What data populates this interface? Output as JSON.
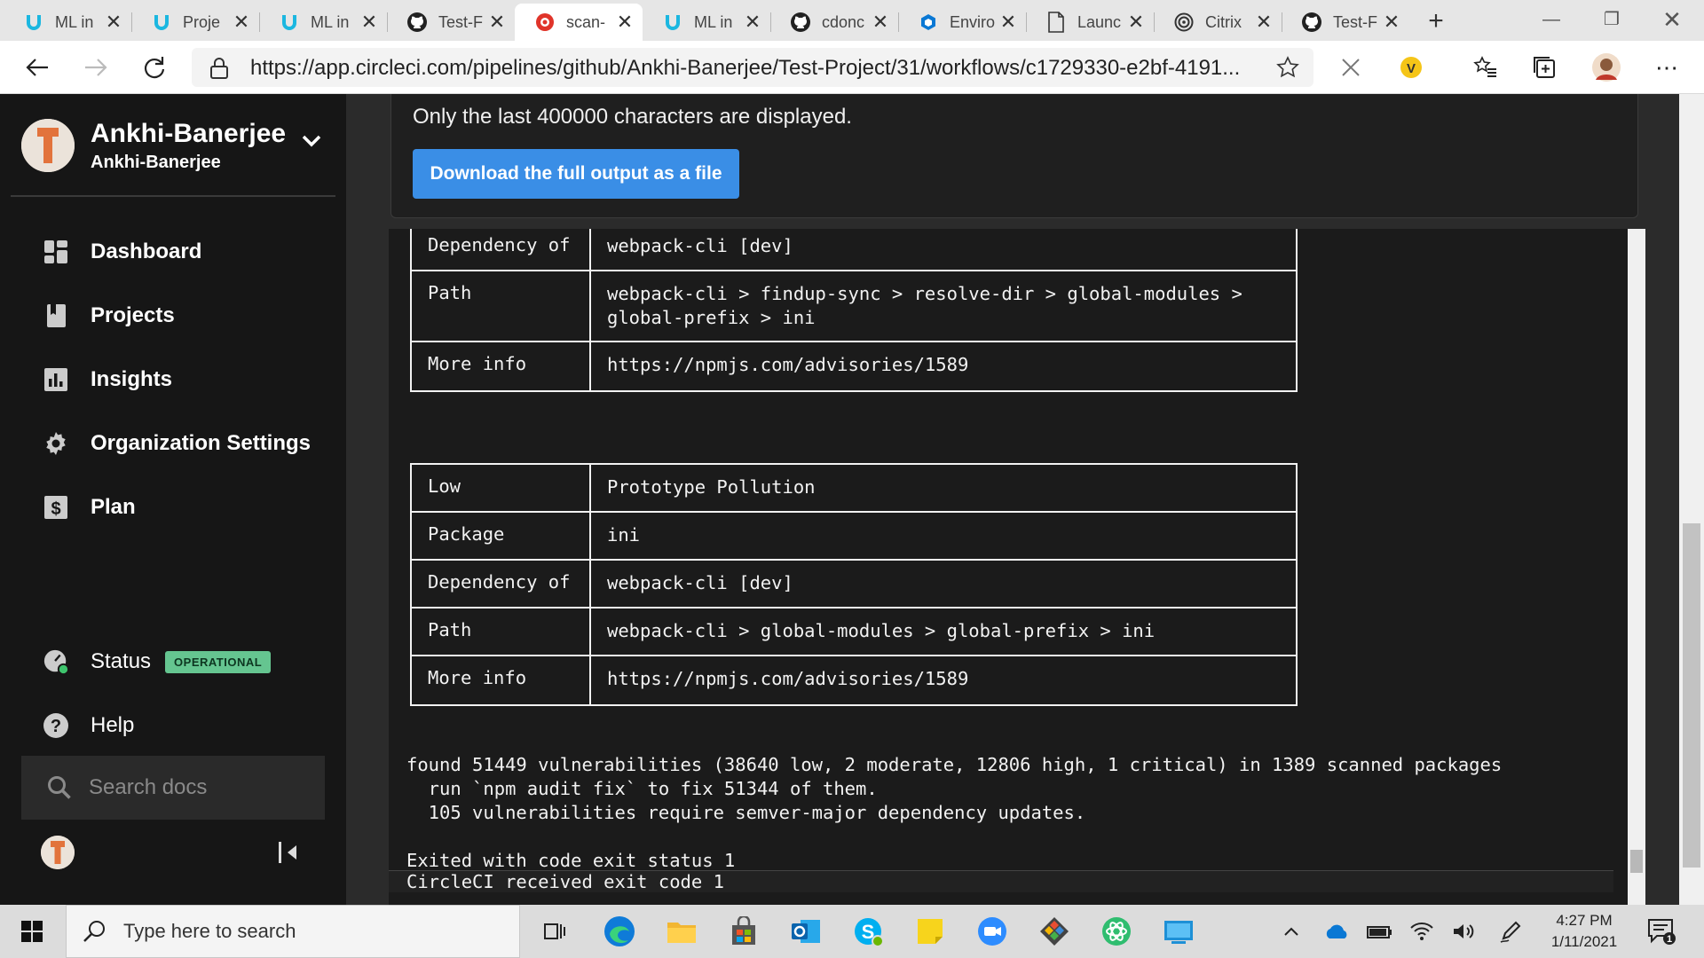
{
  "browser": {
    "tabs": [
      {
        "title": "ML in",
        "icon": "udacity-icon"
      },
      {
        "title": "Proje",
        "icon": "udacity-icon"
      },
      {
        "title": "ML in",
        "icon": "udacity-icon"
      },
      {
        "title": "Test-F",
        "icon": "github-icon"
      },
      {
        "title": "scan-",
        "icon": "circleci-icon",
        "active": true
      },
      {
        "title": "ML in",
        "icon": "udacity-icon"
      },
      {
        "title": "cdonc",
        "icon": "github-icon"
      },
      {
        "title": "Enviro",
        "icon": "azure-icon"
      },
      {
        "title": "Launc",
        "icon": "document-icon"
      },
      {
        "title": "Citrix",
        "icon": "citrix-icon"
      },
      {
        "title": "Test-F",
        "icon": "github-icon"
      }
    ],
    "url": "https://app.circleci.com/pipelines/github/Ankhi-Banerjee/Test-Project/31/workflows/c1729330-e2bf-4191..."
  },
  "sidebar": {
    "org_name": "Ankhi-Banerjee",
    "org_sub": "Ankhi-Banerjee",
    "nav": [
      {
        "label": "Dashboard",
        "icon": "dashboard-icon"
      },
      {
        "label": "Projects",
        "icon": "projects-icon"
      },
      {
        "label": "Insights",
        "icon": "insights-icon"
      },
      {
        "label": "Organization Settings",
        "icon": "gear-icon"
      },
      {
        "label": "Plan",
        "icon": "dollar-icon"
      }
    ],
    "status_label": "Status",
    "status_badge": "OPERATIONAL",
    "help_label": "Help",
    "search_placeholder": "Search docs"
  },
  "output": {
    "message": "Only the last 400000 characters are displayed.",
    "download_label": "Download the full output as a file"
  },
  "terminal": {
    "table1": [
      {
        "key": "Dependency of",
        "value": "webpack-cli [dev]"
      },
      {
        "key": "Path",
        "value": "webpack-cli > findup-sync > resolve-dir > global-modules >\nglobal-prefix > ini"
      },
      {
        "key": "More info",
        "value": "https://npmjs.com/advisories/1589"
      }
    ],
    "table2": [
      {
        "key": "Low",
        "value": "Prototype Pollution"
      },
      {
        "key": "Package",
        "value": "ini"
      },
      {
        "key": "Dependency of",
        "value": "webpack-cli [dev]"
      },
      {
        "key": "Path",
        "value": "webpack-cli > global-modules > global-prefix > ini"
      },
      {
        "key": "More info",
        "value": "https://npmjs.com/advisories/1589"
      }
    ],
    "summary": [
      "found 51449 vulnerabilities (38640 low, 2 moderate, 12806 high, 1 critical) in 1389 scanned packages",
      "  run `npm audit fix` to fix 51344 of them.",
      "  105 vulnerabilities require semver-major dependency updates."
    ],
    "exit_line": "Exited with code exit status 1",
    "received_line": "CircleCI received exit code 1"
  },
  "taskbar": {
    "search_placeholder": "Type here to search",
    "time": "4:27 PM",
    "date": "1/11/2021",
    "notification_count": "1"
  }
}
